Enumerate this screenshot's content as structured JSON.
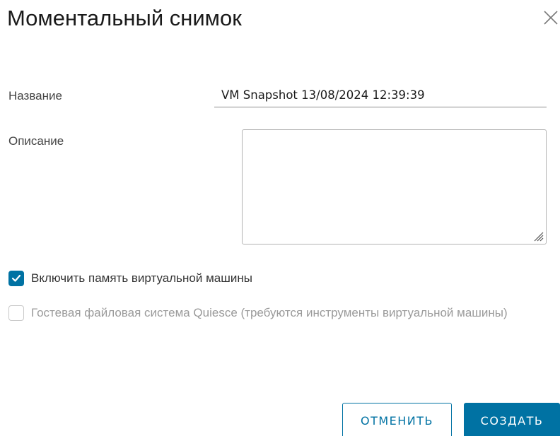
{
  "dialog": {
    "title": "Моментальный снимок",
    "close_icon": "close-icon"
  },
  "form": {
    "name_label": "Название",
    "name_value": "VM Snapshot 13/08/2024 12:39:39",
    "description_label": "Описание",
    "description_value": ""
  },
  "options": {
    "include_memory": {
      "label": "Включить память виртуальной машины",
      "checked": true,
      "disabled": false
    },
    "quiesce": {
      "label": "Гостевая файловая система Quiesce (требуются инструменты виртуальной машины)",
      "checked": false,
      "disabled": true
    }
  },
  "buttons": {
    "cancel_label": "ОТМЕНИТЬ",
    "create_label": "СОЗДАТЬ"
  },
  "colors": {
    "accent": "#0072a3",
    "disabled_text": "#9a9a9a",
    "border": "#b3b3b3"
  }
}
